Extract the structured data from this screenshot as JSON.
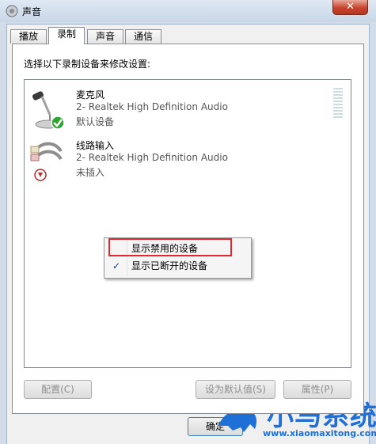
{
  "window": {
    "title": "声音",
    "close_glyph": "✕"
  },
  "tabs": [
    {
      "label": "播放",
      "active": false
    },
    {
      "label": "录制",
      "active": true
    },
    {
      "label": "声音",
      "active": false
    },
    {
      "label": "通信",
      "active": false
    }
  ],
  "panel": {
    "instruction": "选择以下录制设备来修改设置:"
  },
  "devices": [
    {
      "name": "麦克风",
      "description": "2- Realtek High Definition Audio",
      "status": "默认设备",
      "icon": "microphone-icon",
      "badge": "default-check-icon"
    },
    {
      "name": "线路输入",
      "description": "2- Realtek High Definition Audio",
      "status": "未插入",
      "icon": "line-in-cable-icon",
      "badge": "unplugged-arrow-icon"
    }
  ],
  "context_menu": {
    "items": [
      {
        "label": "显示禁用的设备",
        "checked": false
      },
      {
        "label": "显示已断开的设备",
        "checked": true
      }
    ],
    "check_glyph": "✓"
  },
  "buttons": {
    "configure": "配置(C)",
    "set_default": "设为默认值(S)",
    "properties": "属性(P)",
    "ok": "确定"
  },
  "watermark": {
    "title": "小马系统",
    "url": "www.xiaomaxitong.com"
  },
  "colors": {
    "accent": "#1e6fd6",
    "highlight_border": "#e0282e",
    "close_red": "#c7432c"
  }
}
